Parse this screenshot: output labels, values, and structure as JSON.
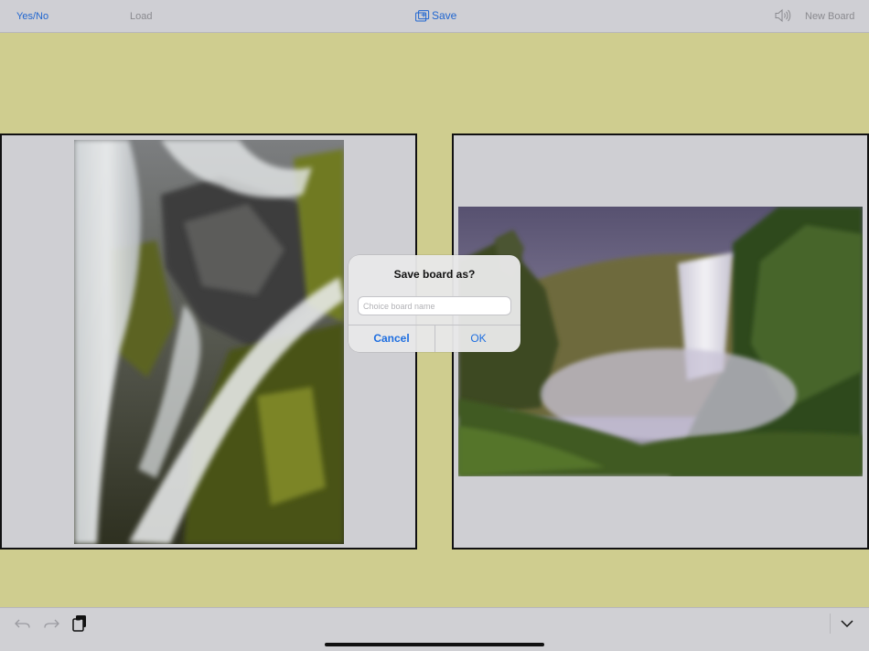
{
  "toolbar": {
    "yes_no_label": "Yes/No",
    "load_label": "Load",
    "save_label": "Save",
    "new_board_label": "New Board",
    "save_icon": "add-to-board-icon",
    "speaker_icon": "speaker-icon"
  },
  "board": {
    "left_photo": "waterfall-over-mossy-rocks-photo",
    "right_photo": "waterfall-in-green-canyon-photo"
  },
  "dialog": {
    "title": "Save board as?",
    "input_value": "",
    "input_placeholder": "Choice board name",
    "cancel_label": "Cancel",
    "ok_label": "OK"
  },
  "bottom_toolbar": {
    "undo_icon": "undo-icon",
    "redo_icon": "redo-icon",
    "paste_icon": "paste-icon",
    "collapse_icon": "chevron-down-icon"
  },
  "colors": {
    "background": "#cfcd8f",
    "accent": "#2066d0",
    "disabled": "#8a8a8f"
  }
}
